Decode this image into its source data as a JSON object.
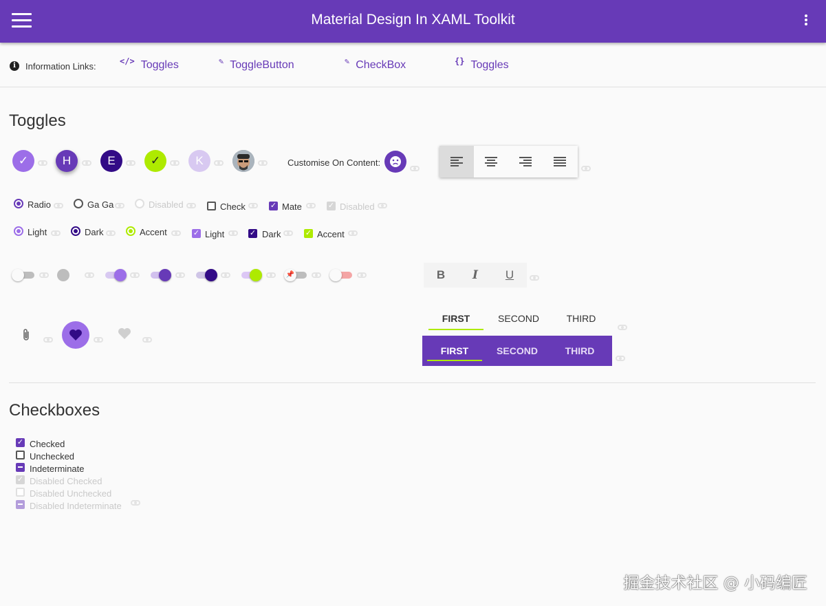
{
  "appbar": {
    "title": "Material Design In XAML Toolkit"
  },
  "info": {
    "label": "Information Links:",
    "links": [
      {
        "icon": "</>",
        "label": "Toggles"
      },
      {
        "icon": "✎",
        "label": "ToggleButton"
      },
      {
        "icon": "✎",
        "label": "CheckBox"
      },
      {
        "icon": "{}",
        "label": "Toggles"
      }
    ]
  },
  "toggles": {
    "title": "Toggles",
    "circles": [
      "✓",
      "H",
      "E",
      "✓",
      "K"
    ],
    "customise_label": "Customise On Content:",
    "radios_row1": [
      {
        "label": "Radio",
        "checked": true
      },
      {
        "label": "Ga Ga",
        "checked": false
      },
      {
        "label": "Disabled",
        "checked": false,
        "disabled": true
      }
    ],
    "checks_row1": [
      {
        "label": "Check",
        "checked": false
      },
      {
        "label": "Mate",
        "checked": true
      },
      {
        "label": "Disabled",
        "checked": true,
        "disabled": true
      }
    ],
    "radios_row2": [
      {
        "label": "Light",
        "color": "#9c6ee8"
      },
      {
        "label": "Dark",
        "color": "#320b86"
      },
      {
        "label": "Accent",
        "color": "#aeea00"
      }
    ],
    "checks_row2": [
      {
        "label": "Light",
        "color": "#9c6ee8"
      },
      {
        "label": "Dark",
        "color": "#320b86"
      },
      {
        "label": "Accent",
        "color": "#aeea00"
      }
    ],
    "format_buttons": [
      "B",
      "I",
      "U"
    ],
    "tabs_plain": [
      "FIRST",
      "SECOND",
      "THIRD"
    ],
    "tabs_filled": [
      "FIRST",
      "SECOND",
      "THIRD"
    ]
  },
  "checkboxes": {
    "title": "Checkboxes",
    "items": [
      {
        "label": "Checked",
        "state": "checked"
      },
      {
        "label": "Unchecked",
        "state": "unchecked"
      },
      {
        "label": "Indeterminate",
        "state": "indeterminate"
      },
      {
        "label": "Disabled Checked",
        "state": "checked",
        "disabled": true
      },
      {
        "label": "Disabled Unchecked",
        "state": "unchecked",
        "disabled": true
      },
      {
        "label": "Disabled Indeterminate",
        "state": "indeterminate",
        "disabled": true
      }
    ]
  },
  "watermark": "掘金技术社区 @ 小码编匠",
  "colors": {
    "primary": "#673ab7",
    "primary_light": "#9c6ee8",
    "primary_dark": "#320b86",
    "accent": "#aeea00"
  }
}
